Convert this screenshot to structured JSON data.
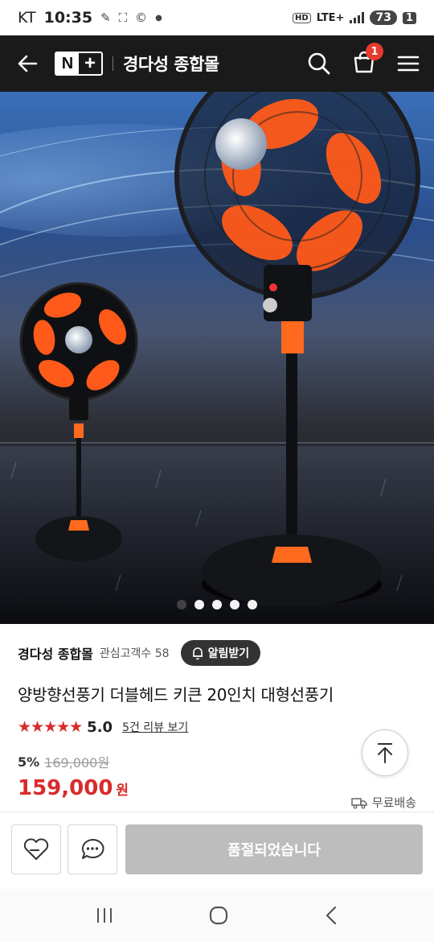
{
  "status_bar": {
    "carrier": "KT",
    "time": "10:35",
    "hd_label": "HD",
    "network": "LTE+",
    "battery": "73",
    "sim_slot": "1"
  },
  "header": {
    "logo_n": "N",
    "logo_plus": "+",
    "store_name": "경다성 종합몰",
    "cart_count": "1"
  },
  "hero": {
    "slide_count": 5,
    "active_slide": 0,
    "image_alt": "양방향 스탠드 선풍기 제품 이미지"
  },
  "product": {
    "seller": "경다성 종합몰",
    "fav_label": "관심고객수 58",
    "alert_label": "알림받기",
    "title": "양방향선풍기 더블헤드 키큰 20인치 대형선풍기",
    "stars": "★★★★★",
    "rating": "5.0",
    "reviews_label": "5건 리뷰 보기",
    "discount": "5%",
    "original_price": "169,000원",
    "price": "159,000",
    "currency": "원",
    "shipping": "무료배송"
  },
  "bottom_bar": {
    "soldout_label": "품절되었습니다"
  },
  "colors": {
    "accent_red": "#d92b2b",
    "header_bg": "#1a1a1a",
    "soldout_bg": "#bdbdbd"
  }
}
